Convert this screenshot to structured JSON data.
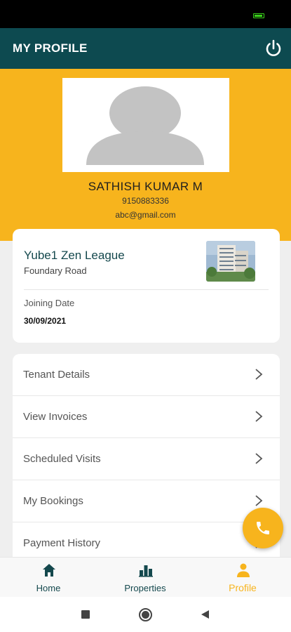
{
  "appbar": {
    "title": "MY PROFILE",
    "logout_icon": "power-icon",
    "background": "#0d4a50"
  },
  "profile": {
    "name": "SATHISH KUMAR M",
    "phone": "9150883336",
    "email": "abc@gmail.com",
    "avatar_icon": "person-placeholder-icon",
    "background": "#f7b41d"
  },
  "property": {
    "name": "Yube1 Zen League",
    "address": "Foundary Road",
    "joining_label": "Joining Date",
    "joining_date": "30/09/2021"
  },
  "menu": {
    "items": [
      {
        "label": "Tenant Details"
      },
      {
        "label": "View Invoices"
      },
      {
        "label": "Scheduled Visits"
      },
      {
        "label": "My Bookings"
      },
      {
        "label": "Payment History"
      }
    ],
    "chevron_icon": "chevron-right-icon"
  },
  "fab": {
    "icon": "phone-icon"
  },
  "bottom_nav": {
    "items": [
      {
        "label": "Home",
        "icon": "home-icon",
        "active": false
      },
      {
        "label": "Properties",
        "icon": "bar-chart-icon",
        "active": false
      },
      {
        "label": "Profile",
        "icon": "person-icon",
        "active": true
      }
    ]
  },
  "colors": {
    "accent": "#f7b41d",
    "brand": "#0d4a50"
  }
}
